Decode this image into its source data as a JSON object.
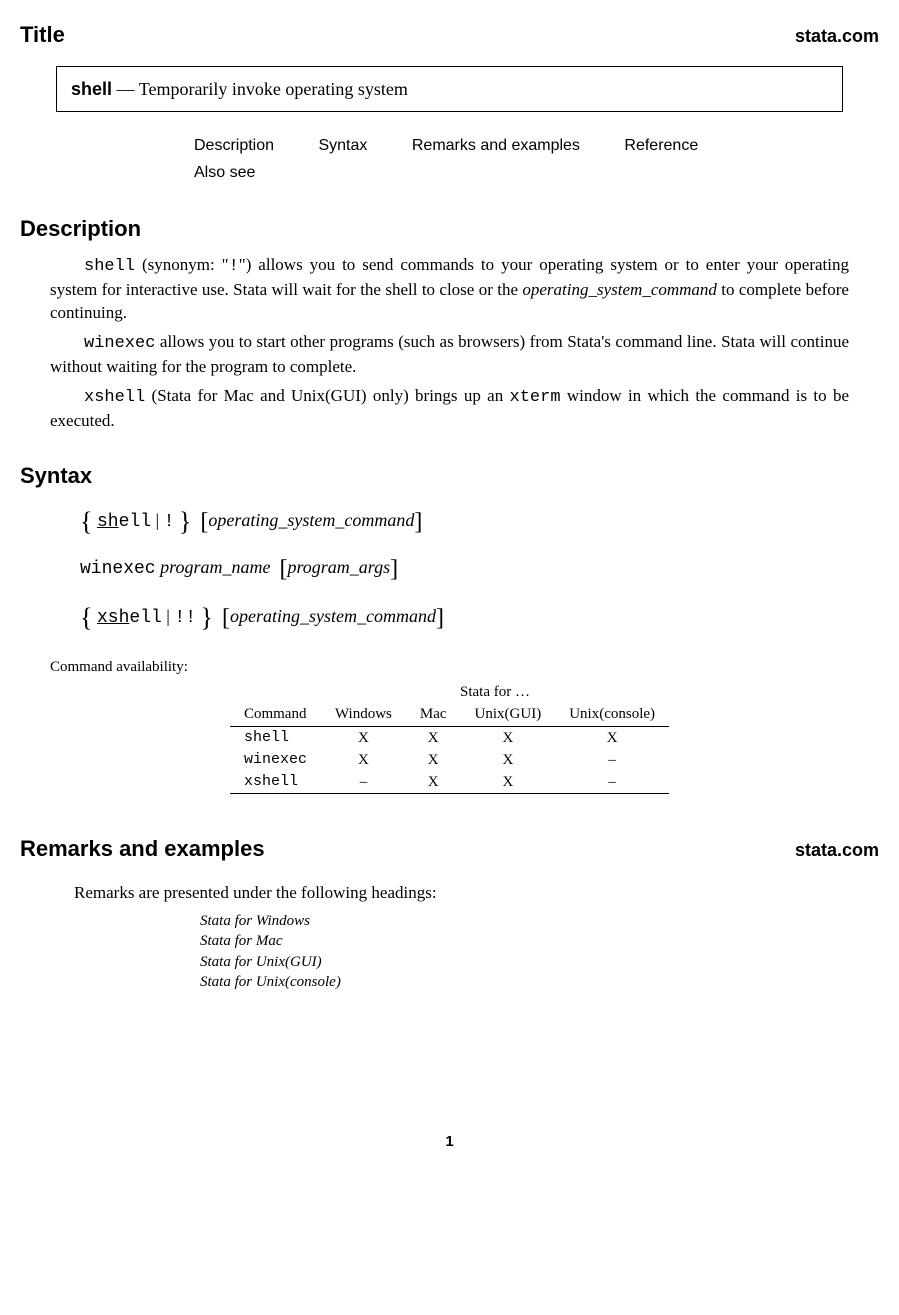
{
  "header": {
    "title": "Title",
    "site": "stata.com",
    "entry_cmd": "shell",
    "entry_dash": " — ",
    "entry_desc": "Temporarily invoke operating system"
  },
  "nav": {
    "l1": "Description",
    "l2": "Syntax",
    "l3": "Remarks and examples",
    "l4": "Reference",
    "l5": "Also see"
  },
  "sections": {
    "description": "Description",
    "syntax": "Syntax",
    "remarks": "Remarks and examples"
  },
  "desc": {
    "p1a": "shell",
    "p1b": " (synonym: \"",
    "p1c": "!",
    "p1d": "\") allows you to send commands to your operating system or to enter your operating system for interactive use.  Stata will wait for the shell to close or the ",
    "p1e": "operating_system_command",
    "p1f": " to complete before continuing.",
    "p2a": "winexec",
    "p2b": " allows you to start other programs (such as browsers) from Stata's command line. Stata will continue without waiting for the program to complete.",
    "p3a": "xshell",
    "p3b": " (Stata for Mac and Unix(GUI) only) brings up an ",
    "p3c": "xterm",
    "p3d": " window in which the command is to be executed."
  },
  "syntax": {
    "s1": {
      "a": "sh",
      "b": "ell",
      "alt": "!",
      "arg": "operating_system_command"
    },
    "s2": {
      "cmd": "winexec",
      "a1": "program_name",
      "a2": "program_args"
    },
    "s3": {
      "a": "xsh",
      "b": "ell",
      "alt": "!!",
      "arg": "operating_system_command"
    }
  },
  "avail": {
    "caption": "Command availability:",
    "h_super": "Stata for …",
    "h_cmd": "Command",
    "h_win": "Windows",
    "h_mac": "Mac",
    "h_gui": "Unix(GUI)",
    "h_con": "Unix(console)",
    "rows": [
      {
        "cmd": "shell",
        "win": "X",
        "mac": "X",
        "gui": "X",
        "con": "X"
      },
      {
        "cmd": "winexec",
        "win": "X",
        "mac": "X",
        "gui": "X",
        "con": "–"
      },
      {
        "cmd": "xshell",
        "win": "–",
        "mac": "X",
        "gui": "X",
        "con": "–"
      }
    ]
  },
  "remarks": {
    "site": "stata.com",
    "intro": "Remarks are presented under the following headings:",
    "items": [
      "Stata for Windows",
      "Stata for Mac",
      "Stata for Unix(GUI)",
      "Stata for Unix(console)"
    ]
  },
  "page": "1"
}
